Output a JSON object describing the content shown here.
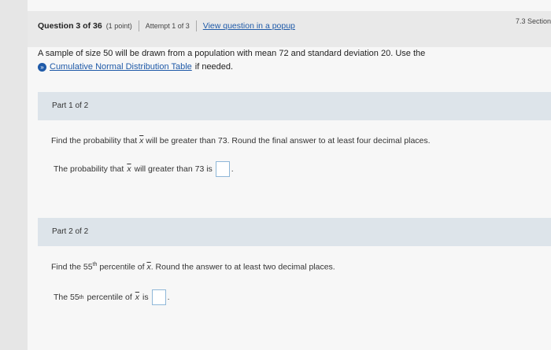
{
  "header": {
    "question": "Question 3 of 36",
    "points": "(1 point)",
    "attempt": "Attempt 1 of 3",
    "popup_link": "View question in a popup",
    "section": "7.3 Section"
  },
  "intro": {
    "text": "A sample of size 50 will be drawn from a population with mean 72 and standard deviation 20. Use the",
    "link": "Cumulative Normal Distribution Table",
    "suffix": "if needed."
  },
  "part1": {
    "label": "Part 1 of 2",
    "prompt_a": "Find the probability that",
    "var": "x",
    "prompt_b": "will be greater than 73. Round the final answer to at least four decimal places.",
    "answer_a": "The probability that",
    "answer_var": "x",
    "answer_b": "will greater than 73 is",
    "answer_end": "."
  },
  "part2": {
    "label": "Part 2 of 2",
    "prompt_a": "Find the 55",
    "sup": "th",
    "prompt_b": "percentile of",
    "var": "x",
    "prompt_c": ". Round the answer to at least two decimal places.",
    "answer_a": "The 55",
    "answer_sup": "th",
    "answer_b": "percentile of",
    "answer_var": "x",
    "answer_c": "is",
    "answer_end": "."
  }
}
